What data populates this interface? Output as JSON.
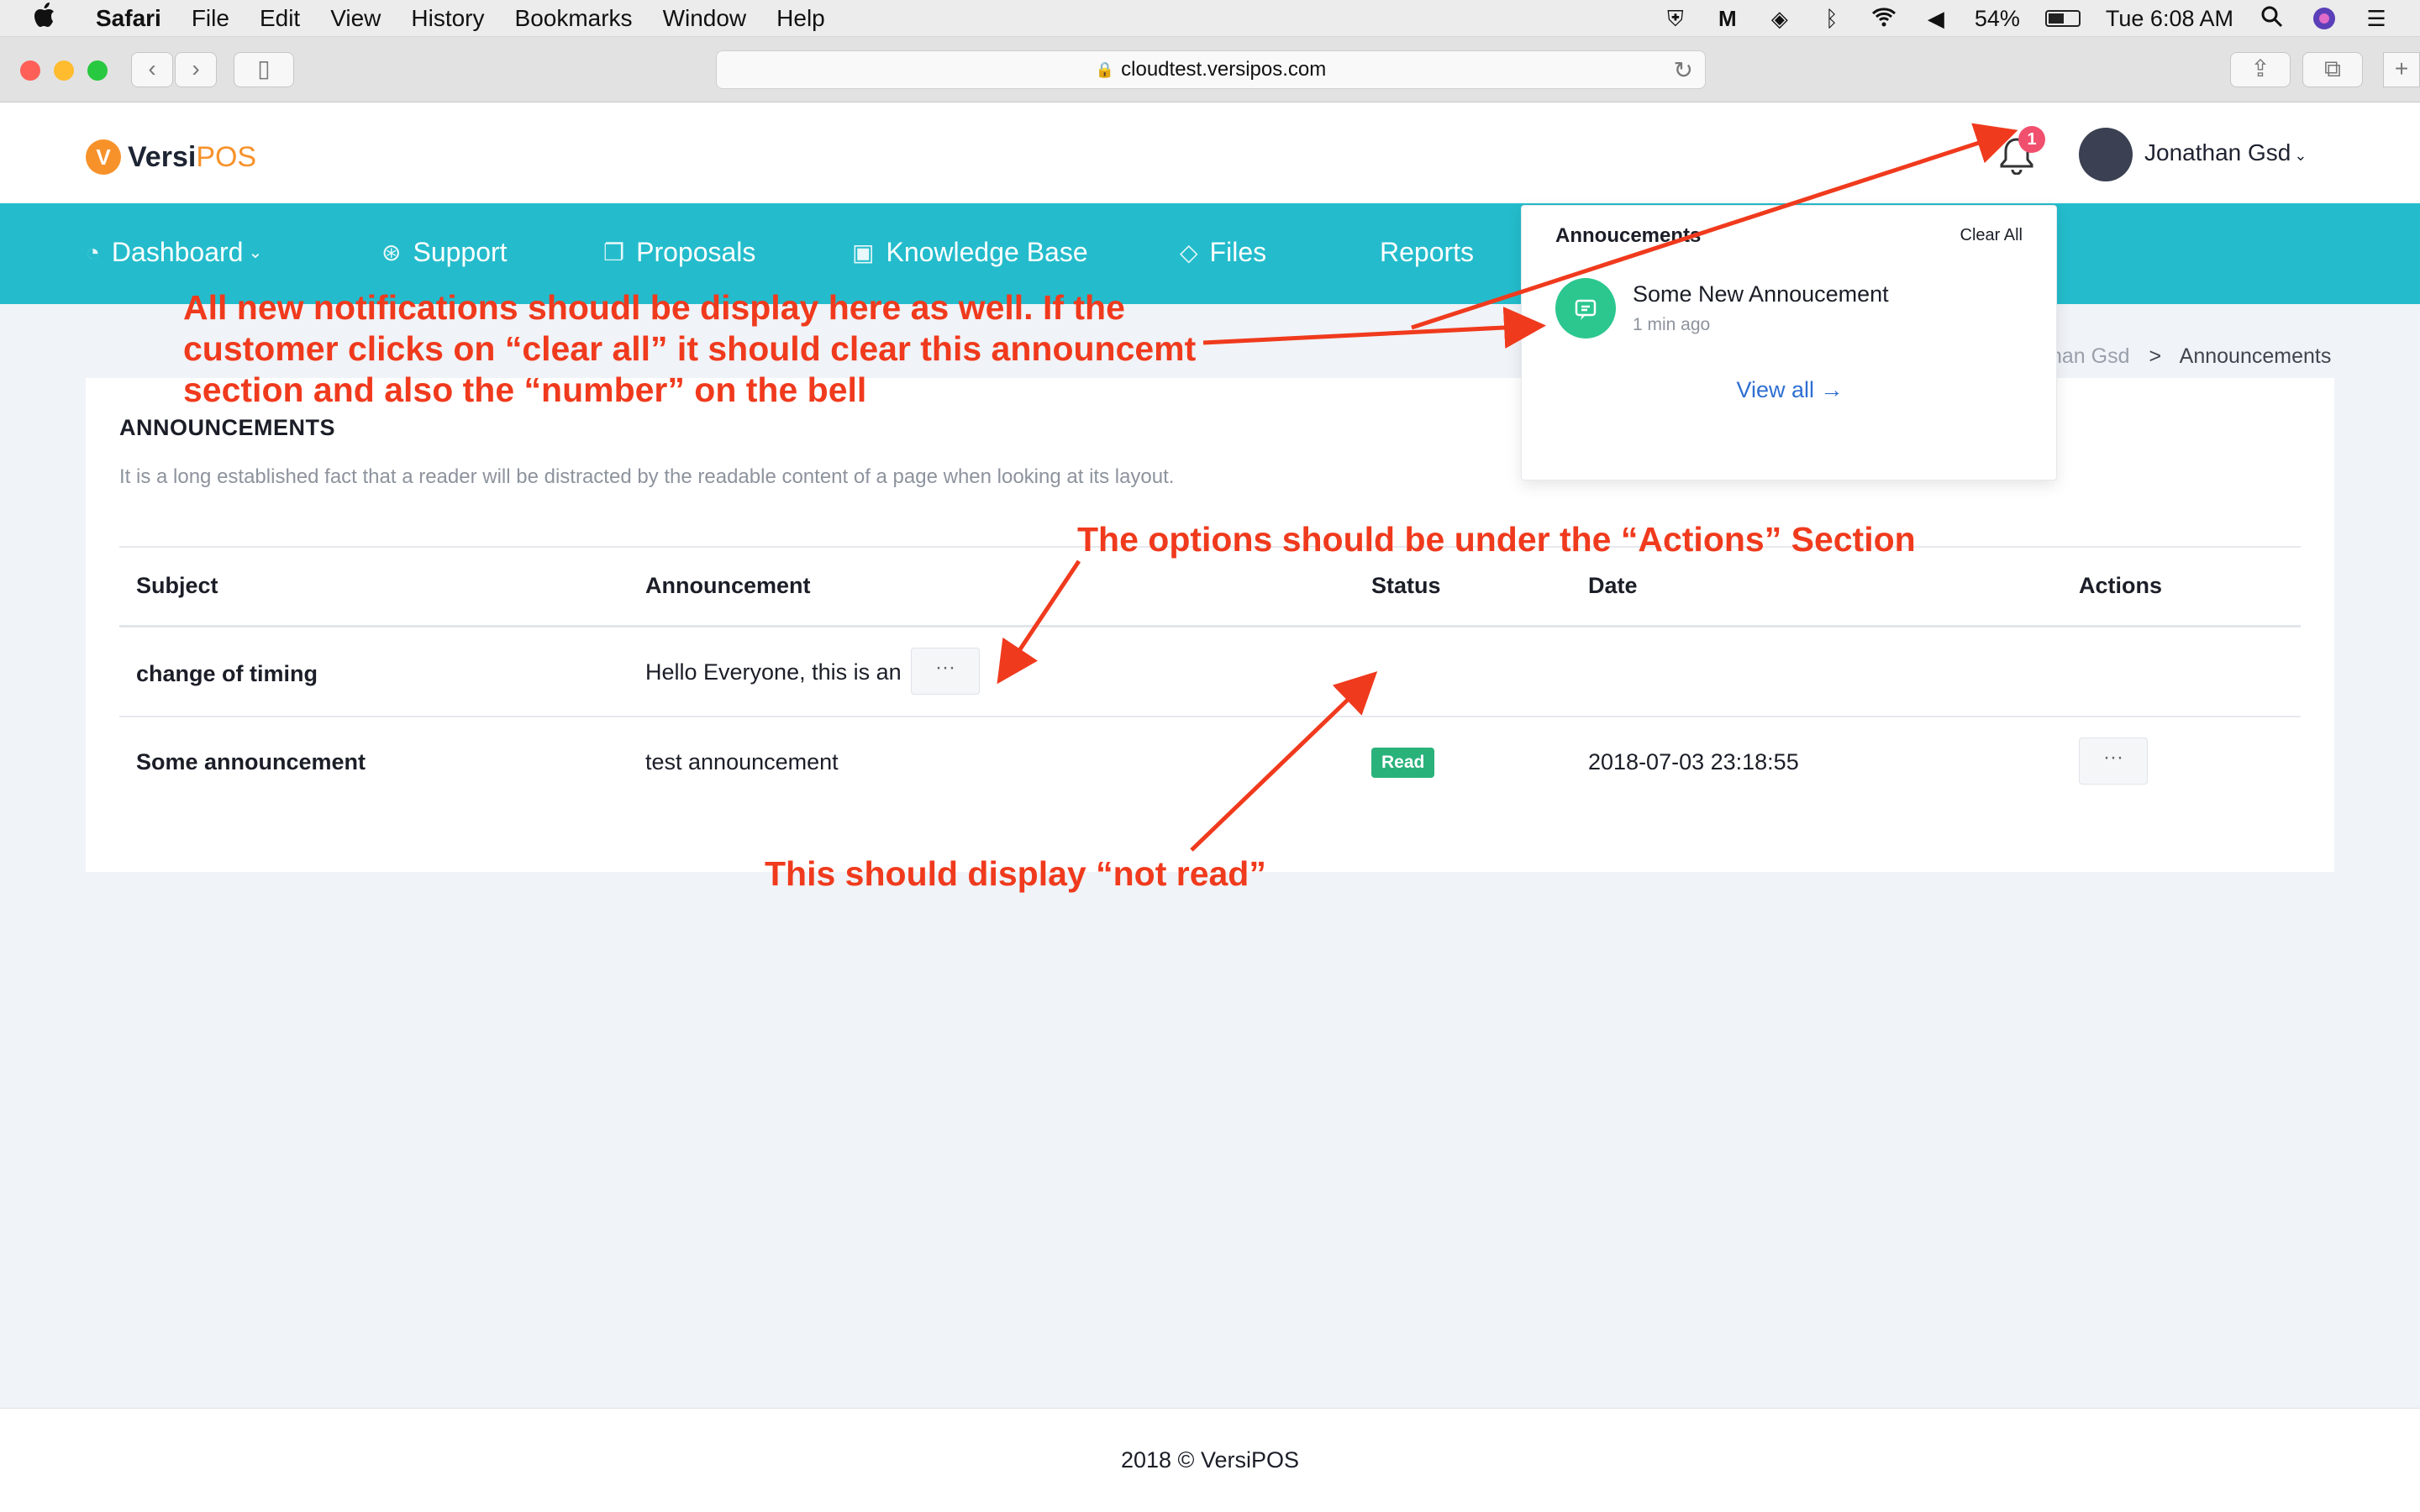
{
  "menubar": {
    "apple": "",
    "app": "Safari",
    "items": [
      "File",
      "Edit",
      "View",
      "History",
      "Bookmarks",
      "Window",
      "Help"
    ],
    "battery": "54%",
    "clock": "Tue 6:08 AM"
  },
  "browser": {
    "url": "cloudtest.versipos.com"
  },
  "header": {
    "logo_mark": "V",
    "logo_part1": "Versi",
    "logo_part2": "POS",
    "notification_count": "1",
    "user_name": "Jonathan Gsd"
  },
  "nav": {
    "items": [
      {
        "label": "Dashboard",
        "icon": "gauge-icon"
      },
      {
        "label": "Support",
        "icon": "lifebuoy-icon"
      },
      {
        "label": "Proposals",
        "icon": "documents-icon"
      },
      {
        "label": "Knowledge Base",
        "icon": "briefcase-icon"
      },
      {
        "label": "Files",
        "icon": "layers-icon"
      },
      {
        "label": "Reports",
        "icon": ""
      }
    ]
  },
  "breadcrumb": {
    "parent": "han Gsd",
    "separator": ">",
    "current": "Announcements"
  },
  "page": {
    "title": "ANNOUNCEMENTS",
    "description": "It is a long established fact that a reader will be distracted by the readable content of a page when looking at its layout."
  },
  "table": {
    "columns": [
      "Subject",
      "Announcement",
      "Status",
      "Date",
      "Actions"
    ],
    "rows": [
      {
        "subject": "change of timing",
        "announcement": "Hello Everyone, this is an",
        "status": "",
        "date": "",
        "actions": "···"
      },
      {
        "subject": "Some announcement",
        "announcement": "test announcement",
        "status": "Read",
        "date": "2018-07-03 23:18:55",
        "actions": "···"
      }
    ]
  },
  "dropdown": {
    "title": "Annoucements",
    "clear_all": "Clear All",
    "item_title": "Some New Annoucement",
    "item_time": "1 min ago",
    "view_all": "View all →"
  },
  "footer": {
    "text": "2018 © VersiPOS"
  },
  "annotations": {
    "notifications_note_line1": "All new notifications shoudl be display here as well. If the",
    "notifications_note_line2": "customer clicks on “clear all” it should clear this announcemt",
    "notifications_note_line3": "section  and also the “number” on the bell",
    "actions_note": "The options should be under the “Actions” Section",
    "status_note": "This should display “not read”"
  },
  "colors": {
    "nav_bg": "#24bccc",
    "brand_orange": "#f7922a",
    "annotation_red": "#f03a1d",
    "status_green": "#2ab27b",
    "badge_red": "#f0506e"
  }
}
